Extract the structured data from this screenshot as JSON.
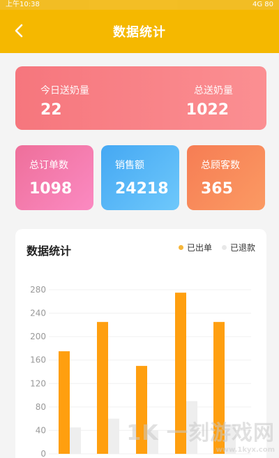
{
  "statusbar": {
    "time": "上午10:38",
    "right": "4G 80"
  },
  "navbar": {
    "title": "数据统计",
    "back_icon": "chevron-left-icon"
  },
  "summary": {
    "today_label": "今日送奶量",
    "today_value": "22",
    "total_label": "总送奶量",
    "total_value": "1022"
  },
  "stats": [
    {
      "label": "总订单数",
      "value": "1098"
    },
    {
      "label": "销售额",
      "value": "24218"
    },
    {
      "label": "总顾客数",
      "value": "365"
    }
  ],
  "chart_card": {
    "title": "数据统计",
    "legend": [
      {
        "label": "已出单",
        "color": "#f6b63a"
      },
      {
        "label": "已退款",
        "color": "#e8e8e8"
      }
    ]
  },
  "chart_data": {
    "type": "bar",
    "categories": [
      "",
      "",
      "",
      "",
      ""
    ],
    "series": [
      {
        "name": "已出单",
        "values": [
          175,
          225,
          150,
          275,
          225
        ]
      },
      {
        "name": "已退款",
        "values": [
          45,
          60,
          40,
          90,
          50
        ]
      }
    ],
    "yticks": [
      "0",
      "40",
      "80",
      "120",
      "160",
      "200",
      "240",
      "280"
    ],
    "ylim": [
      0,
      300
    ],
    "colors": {
      "out": "#ff9f0f",
      "ret": "#eeeeee"
    },
    "grid": true
  },
  "watermark": {
    "text": "1K 一刻游戏网",
    "sub": "www.1kyx.com"
  }
}
